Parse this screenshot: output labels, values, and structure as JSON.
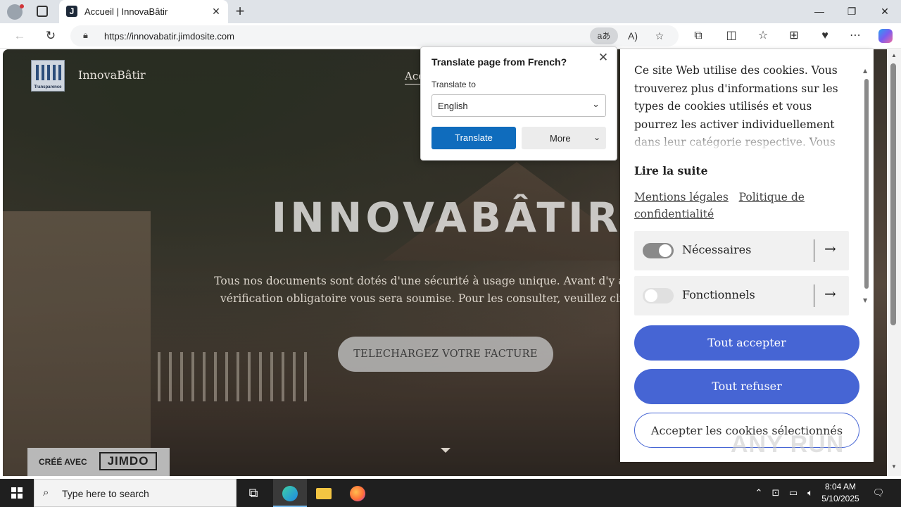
{
  "browser": {
    "tab_title": "Accueil | InnovaBâtir",
    "tab_favicon": "J",
    "url": "https://innovabatir.jimdosite.com",
    "translate_icon": "aあ",
    "read_aloud_icon": "A)"
  },
  "site": {
    "name": "InnovaBâtir",
    "logo_caption": "Transparence",
    "nav_item": "Acc",
    "hero_title": "INNOVABÂTIR",
    "hero_line1": "Tous nos documents sont dotés d'une sécurité à usage unique. Avant d'y accéder,",
    "hero_line2": "vérification obligatoire vous sera soumise. Pour les consulter, veuillez cliquer c",
    "download_button": "TELECHARGEZ VOTRE FACTURE",
    "made_with": "CRÉÉ AVEC",
    "made_with_brand": "JIMDO"
  },
  "translate_popup": {
    "heading": "Translate page from French?",
    "to_label": "Translate to",
    "language": "English",
    "translate_button": "Translate",
    "more_button": "More"
  },
  "cookie_panel": {
    "text": "Ce site Web utilise des cookies. Vous trouverez plus d'informations sur les types de cookies utilisés et vous pourrez les activer individuellement dans leur catégorie respective. Vous pouvez",
    "read_more": "Lire la suite",
    "link_legal": "Mentions légales",
    "link_privacy": "Politique de confidentialité",
    "categories": [
      {
        "label": "Nécessaires",
        "enabled": true
      },
      {
        "label": "Fonctionnels",
        "enabled": false
      }
    ],
    "accept_all": "Tout accepter",
    "refuse_all": "Tout refuser",
    "accept_selected": "Accepter les cookies sélectionnés"
  },
  "watermark": "ANY RUN",
  "taskbar": {
    "search_placeholder": "Type here to search",
    "time": "8:04 AM",
    "date": "5/10/2025"
  },
  "colors": {
    "accent_blue": "#4665d4",
    "translate_blue": "#0f6cbd",
    "taskbar": "#1f1f1f"
  }
}
